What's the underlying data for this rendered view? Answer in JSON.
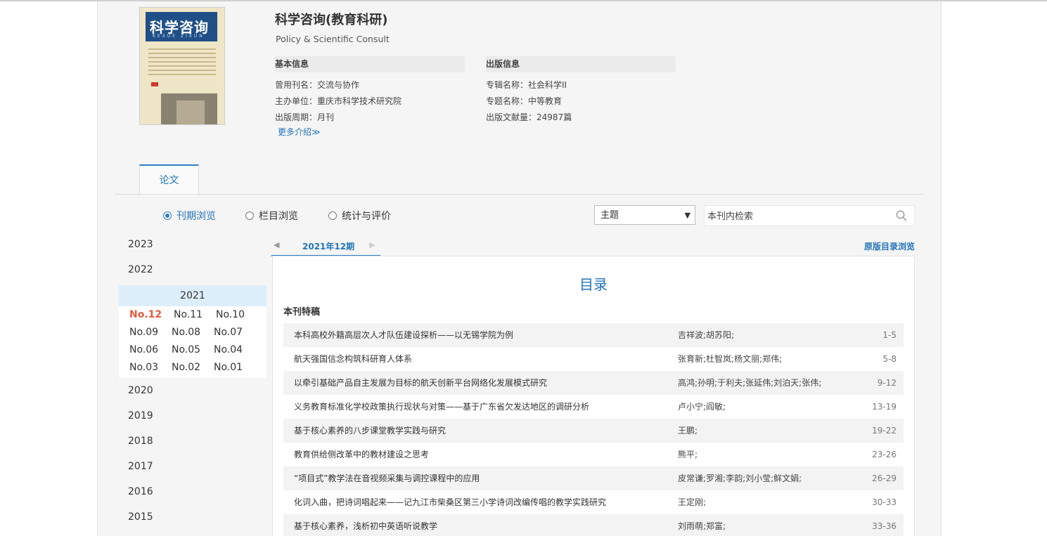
{
  "journal": {
    "title": "科学咨询(教育科研)",
    "subtitle": "Policy & Scientific Consult",
    "cover_title": "科学咨询",
    "cover_pinyin": "KEXUE ZIXUN"
  },
  "basic_info": {
    "heading": "基本信息",
    "rows": [
      {
        "label": "曾用刊名：",
        "value": "交流与协作"
      },
      {
        "label": "主办单位：",
        "value": "重庆市科学技术研究院"
      },
      {
        "label": "出版周期：",
        "value": "月刊"
      }
    ],
    "more_label": "更多介绍≫"
  },
  "pub_info": {
    "heading": "出版信息",
    "rows": [
      {
        "label": "专辑名称：",
        "value": "社会科学II"
      },
      {
        "label": "专题名称：",
        "value": "中等教育"
      },
      {
        "label": "出版文献量：",
        "value": "24987篇"
      }
    ]
  },
  "tabs": [
    {
      "label": "论文"
    }
  ],
  "view_options": [
    {
      "label": "刊期浏览",
      "selected": true
    },
    {
      "label": "栏目浏览",
      "selected": false
    },
    {
      "label": "统计与评价",
      "selected": false
    }
  ],
  "search": {
    "field_selected": "主题",
    "placeholder": "本刊内检索"
  },
  "years": [
    "2023",
    "2022",
    "2021",
    "2020",
    "2019",
    "2018",
    "2017",
    "2016",
    "2015"
  ],
  "active_year": "2021",
  "issues": [
    [
      "No.12",
      "No.11",
      "No.10"
    ],
    [
      "No.09",
      "No.08",
      "No.07"
    ],
    [
      "No.06",
      "No.05",
      "No.04"
    ],
    [
      "No.03",
      "No.02",
      "No.01"
    ]
  ],
  "current_issue": "2021年12期",
  "original_toc_link": "原版目录浏览",
  "toc": {
    "title": "目录",
    "section": "本刊特稿",
    "articles": [
      {
        "title": "本科高校外籍高层次人才队伍建设探析——以无锡学院为例",
        "authors": "吉祥波;胡苏阳;",
        "pages": "1-5"
      },
      {
        "title": "航天强国信念构筑科研育人体系",
        "authors": "张育新;杜智岚;杨文丽;郑伟;",
        "pages": "5-8"
      },
      {
        "title": "以牵引基础产品自主发展为目标的航天创新平台网络化发展模式研究",
        "authors": "高鸿;孙明;于利夫;张延伟;刘泊天;张伟;",
        "pages": "9-12"
      },
      {
        "title": "义务教育标准化学校政策执行现状与对策——基于广东省欠发达地区的调研分析",
        "authors": "卢小宁;阎敏;",
        "pages": "13-19"
      },
      {
        "title": "基于核心素养的八步课堂教学实践与研究",
        "authors": "王鹏;",
        "pages": "19-22"
      },
      {
        "title": "教育供给侧改革中的教材建设之思考",
        "authors": "熊平;",
        "pages": "23-26"
      },
      {
        "title": "“项目式”教学法在音视频采集与调控课程中的应用",
        "authors": "皮常谦;罗湘;李韵;刘小莹;鲜文娟;",
        "pages": "26-29"
      },
      {
        "title": "化词入曲，把诗词唱起来——记九江市柴桑区第三小学诗词改编传唱的教学实践研究",
        "authors": "王定刚;",
        "pages": "30-33"
      },
      {
        "title": "基于核心素养，浅析初中英语听说教学",
        "authors": "刘雨萌;郑富;",
        "pages": "33-36"
      }
    ]
  },
  "colors": {
    "accent": "#2273b8",
    "current_issue": "#e55b3f",
    "page_bg": "#f5f5f5"
  }
}
